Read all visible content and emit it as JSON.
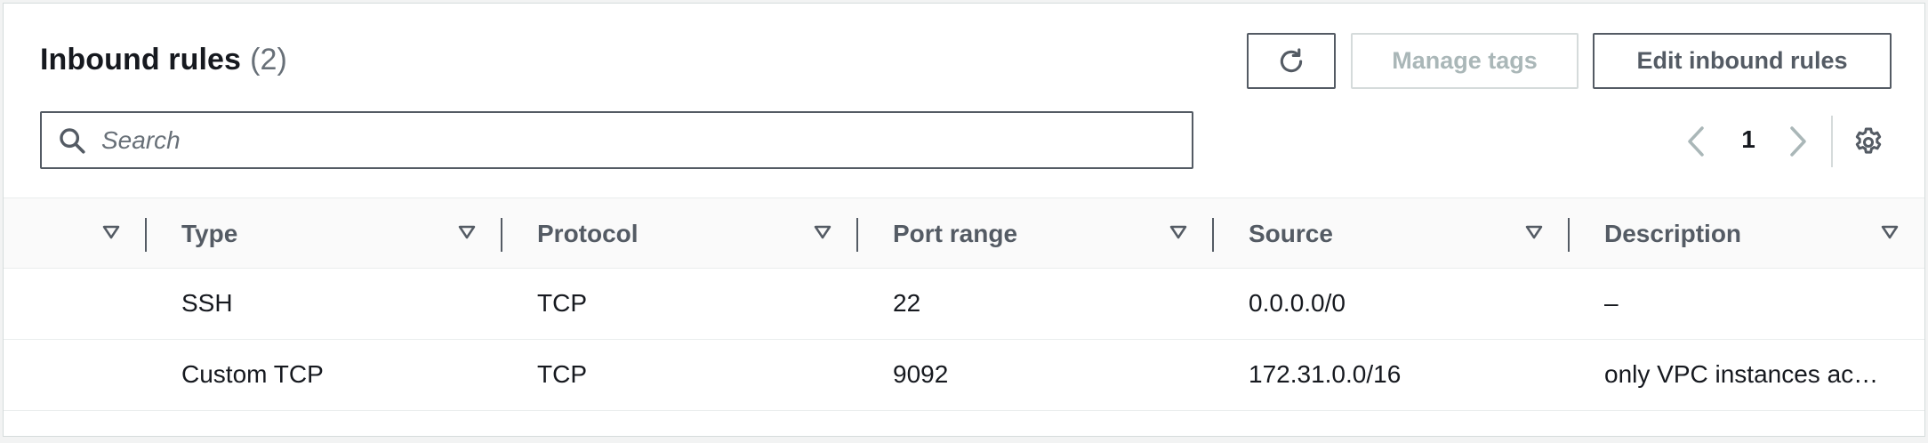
{
  "header": {
    "title": "Inbound rules",
    "count": "(2)"
  },
  "toolbar": {
    "refresh_icon": "refresh-icon",
    "manage_tags_label": "Manage tags",
    "edit_label": "Edit inbound rules"
  },
  "search": {
    "placeholder": "Search",
    "value": ""
  },
  "pagination": {
    "current_page": "1",
    "prev_icon": "chevron-left-icon",
    "next_icon": "chevron-right-icon",
    "settings_icon": "gear-icon"
  },
  "table": {
    "columns": [
      "Type",
      "Protocol",
      "Port range",
      "Source",
      "Description"
    ],
    "rows": [
      [
        "SSH",
        "TCP",
        "22",
        "0.0.0.0/0",
        "–"
      ],
      [
        "Custom TCP",
        "TCP",
        "9092",
        "172.31.0.0/16",
        "only VPC instances acc…"
      ]
    ]
  },
  "colors": {
    "text": "#16191f",
    "border": "#545b64",
    "disabled": "#aab7b8",
    "header_bg": "#fafafa"
  }
}
